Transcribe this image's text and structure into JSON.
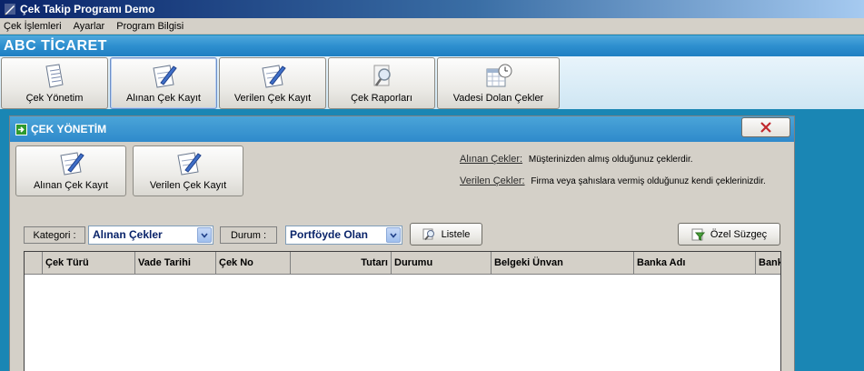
{
  "window": {
    "title": "Çek Takip Programı Demo"
  },
  "menu": [
    "Çek İşlemleri",
    "Ayarlar",
    "Program Bilgisi"
  ],
  "company": {
    "name": "ABC TİCARET"
  },
  "toolbar": [
    {
      "label": "Çek Yönetim",
      "icon": "document-list-icon"
    },
    {
      "label": "Alınan Çek Kayıt",
      "icon": "pen-check-icon"
    },
    {
      "label": "Verilen Çek Kayıt",
      "icon": "pen-check-icon"
    },
    {
      "label": "Çek Raporları",
      "icon": "magnifier-report-icon"
    },
    {
      "label": "Vadesi Dolan Çekler",
      "icon": "calendar-clock-icon"
    }
  ],
  "child": {
    "title": "ÇEK YÖNETİM",
    "buttons": [
      {
        "label": "Alınan Çek Kayıt"
      },
      {
        "label": "Verilen Çek Kayıt"
      }
    ],
    "info": [
      {
        "key": "Alınan Çekler:",
        "text": "Müşterinizden almış olduğunuz çeklerdir."
      },
      {
        "key": "Verilen Çekler:",
        "text": "Firma veya şahıslara vermiş olduğunuz kendi çeklerinizdir."
      }
    ],
    "filters": {
      "kategori_label": "Kategori :",
      "kategori_value": "Alınan Çekler",
      "durum_label": "Durum :",
      "durum_value": "Portföyde Olan",
      "listele_label": "Listele",
      "ozel_label": "Özel Süzgeç"
    },
    "columns": [
      "Çek Türü",
      "Vade Tarihi",
      "Çek No",
      "Tutarı",
      "Durumu",
      "Belgeki Ünvan",
      "Banka Adı",
      "Bank"
    ]
  },
  "colors": {
    "accent": "#2f8acb",
    "combo_text": "#0a246a",
    "close_x": "#c0282d"
  }
}
